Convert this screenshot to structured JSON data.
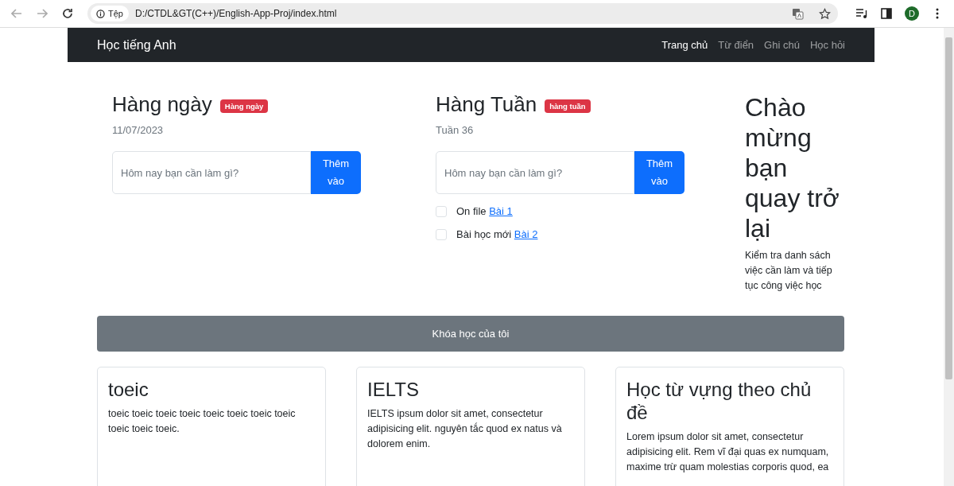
{
  "browser": {
    "chip": "Tệp",
    "url": "D:/CTDL&GT(C++)/English-App-Proj/index.html",
    "avatar": "D"
  },
  "navbar": {
    "brand": "Học tiếng Anh",
    "links": [
      {
        "label": "Trang chủ",
        "selected": true
      },
      {
        "label": "Từ điển",
        "selected": false
      },
      {
        "label": "Ghi chú",
        "selected": false
      },
      {
        "label": "Học hỏi",
        "selected": false
      }
    ]
  },
  "columns": [
    {
      "title": "Hàng ngày",
      "badge": "Hàng ngày",
      "subtitle": "11/07/2023",
      "placeholder": "Hôm nay bạn cần làm gì?",
      "button": "Thêm vào"
    },
    {
      "title": "Hàng Tuần",
      "badge": "hàng tuần",
      "subtitle": "Tuần 36",
      "placeholder": "Hôm nay bạn cần làm gì?",
      "button": "Thêm vào",
      "tasks": [
        {
          "text": "On file",
          "link": "Bài 1",
          "checked": false
        },
        {
          "text": "Bài học mới",
          "link": "Bài 2",
          "checked": false
        }
      ]
    }
  ],
  "welcome": {
    "title": "Chào mừng bạn quay trở lại",
    "text": "Kiểm tra danh sách việc cần làm và tiếp tục công việc học"
  },
  "courses": {
    "header": "Khóa học của tôi",
    "cards": [
      {
        "title": "toeic",
        "text": "toeic toeic toeic toeic toeic toeic toeic toeic toeic toeic toeic."
      },
      {
        "title": "IELTS",
        "text": "IELTS ipsum dolor sit amet, consectetur adipisicing elit. nguyên tắc quod ex natus và dolorem enim."
      },
      {
        "title": "Học từ vựng theo chủ đề",
        "text": "Lorem ipsum dolor sit amet, consectetur adipisicing elit. Rem vĩ đại quas ex numquam, maxime trừ quam molestias corporis quod, ea"
      }
    ]
  }
}
